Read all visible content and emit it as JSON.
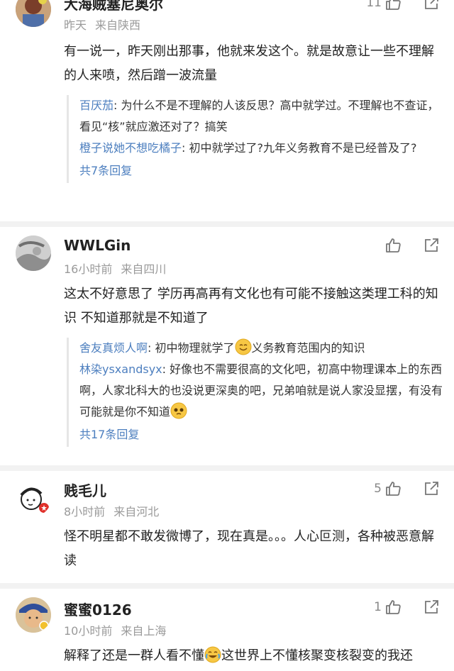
{
  "comments": [
    {
      "username": "大海贼塞尼奥尔",
      "time": "昨天",
      "location": "来自陕西",
      "likes": "11",
      "text": "有一说一，昨天刚出那事，他就来发这个。就是故意让一些不理解的人来喷，然后蹭一波流量",
      "replies": [
        {
          "name": "百厌茄",
          "text": "为什么不是不理解的人该反思？高中就学过。不理解也不查证，看见“核”就应激还对了？搞笑"
        },
        {
          "name": "橙子说她不想吃橘子",
          "text": "初中就学过了?九年义务教育不是已经普及了?"
        }
      ],
      "more_replies": "共7条回复"
    },
    {
      "username": "WWLGin",
      "time": "16小时前",
      "location": "来自四川",
      "likes": "",
      "text": "这太不好意思了 学历再高再有文化也有可能不接触这类理工科的知识 不知道那就是不知道了",
      "replies": [
        {
          "name": "舍友真烦人啊",
          "text_a": "初中物理就学了",
          "text_b": "义务教育范围内的知识"
        },
        {
          "name": "林染ysxandsyx",
          "text": "好像也不需要很高的文化吧，初高中物理课本上的东西啊，人家北科大的也没说更深奥的吧，兄弟咱就是说人家没显摆，有没有可能就是你不知道"
        }
      ],
      "more_replies": "共17条回复"
    },
    {
      "username": "贱毛儿",
      "time": "8小时前",
      "location": "来自河北",
      "likes": "5",
      "text": "怪不明星都不敢发微博了，现在真是。。。人心叵测，各种被恶意解读"
    },
    {
      "username": "蜜蜜0126",
      "time": "10小时前",
      "location": "来自上海",
      "likes": "1",
      "text_a": "解释了还是一群人看不懂",
      "text_b": "这世界上不懂核聚变核裂变的我还"
    }
  ],
  "colors": {
    "username_link": "#4d7fbf",
    "meta_gray": "#9a9a9a",
    "divider": "#f2f2f2"
  }
}
